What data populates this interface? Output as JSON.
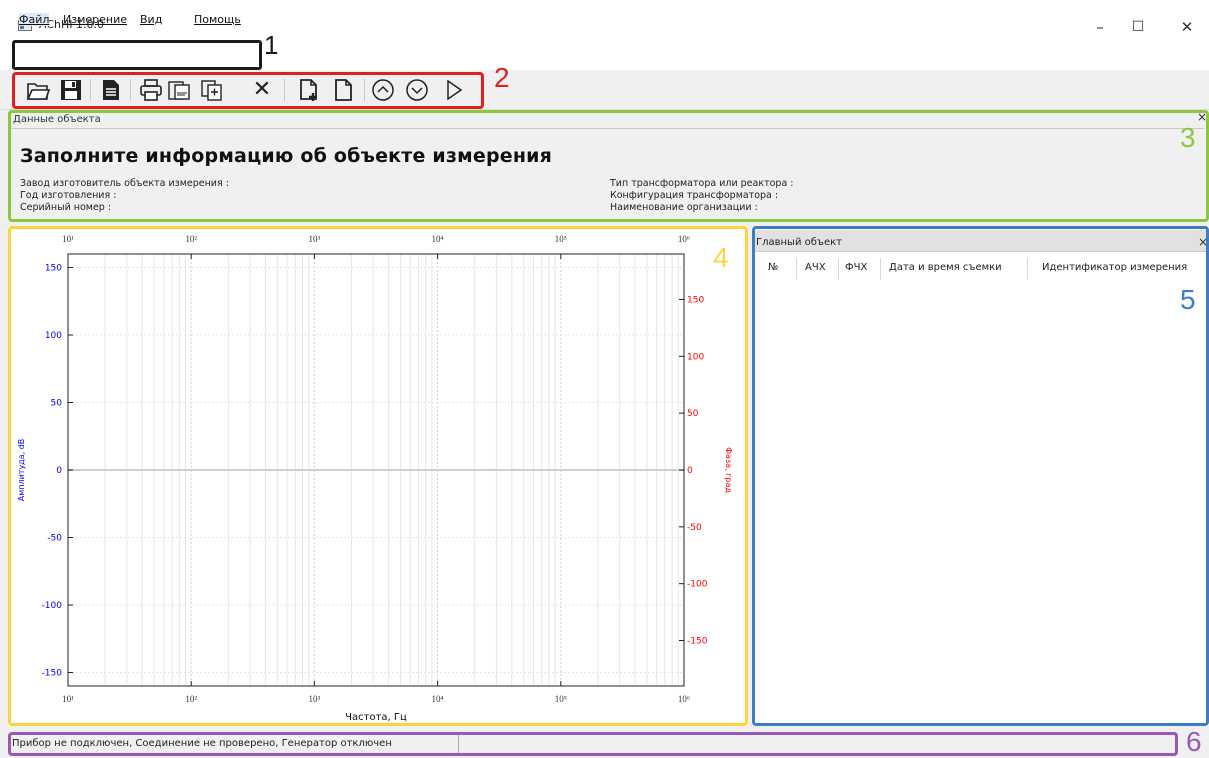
{
  "window": {
    "title": "AChHI 1.0.0",
    "minimize": "–",
    "maximize": "☐",
    "close": "✕"
  },
  "menu": [
    "Файл",
    "Измерение",
    "Вид",
    "Помощь"
  ],
  "toolbar": {
    "icons": [
      "open-folder-icon",
      "save-icon",
      "document-icon",
      "print-icon",
      "pdf-export-icon",
      "copy-icon",
      "delete-icon",
      "add-file-icon",
      "new-file-icon",
      "up-icon",
      "down-icon",
      "play-icon"
    ],
    "delete_glyph": "✕"
  },
  "object_panel": {
    "header": "Данные объекта",
    "title": "Заполните информацию об объекте измерения",
    "close": "×",
    "left_fields": [
      "Завод изготовитель объекта измерения :",
      "Год изготовления :",
      "Серийный номер :"
    ],
    "right_fields": [
      "Тип трансформатора или реактора :",
      "Конфигурация трансформатора :",
      "Наименование организации :"
    ]
  },
  "chart_data": {
    "type": "line",
    "xlabel": "Частота, Гц",
    "ylabel_left": "Амплитуда, dB",
    "ylabel_right": "Фаза, град",
    "x_scale": "log",
    "xlim": [
      10,
      1000000
    ],
    "x_ticks": [
      "10¹",
      "10²",
      "10³",
      "10⁴",
      "10⁵",
      "10⁶"
    ],
    "ylim_left": [
      -160,
      160
    ],
    "y_ticks_left": [
      "150",
      "100",
      "50",
      "0",
      "-50",
      "-100",
      "-150"
    ],
    "ylim_right": [
      -190,
      190
    ],
    "y_ticks_right": [
      "150",
      "100",
      "50",
      "0",
      "-50",
      "-100",
      "-150"
    ],
    "grid": true,
    "left_axis_color": "#0000ff",
    "right_axis_color": "#ff0000",
    "series": []
  },
  "main_object_panel": {
    "header": "Главный объект",
    "close": "×",
    "columns": [
      "№",
      "АЧХ",
      "ФЧХ",
      "Дата и время съемки",
      "Идентификатор измерения"
    ]
  },
  "status": {
    "text": "Прибор не подключен, Соединение не проверено, Генератор отключен"
  },
  "annotations": {
    "labels": [
      "1",
      "2",
      "3",
      "4",
      "5",
      "6"
    ],
    "colors": [
      "#1a1a1a",
      "#e02020",
      "#8dc63f",
      "#ffd23f",
      "#3c7dc4",
      "#9b59b6"
    ]
  }
}
